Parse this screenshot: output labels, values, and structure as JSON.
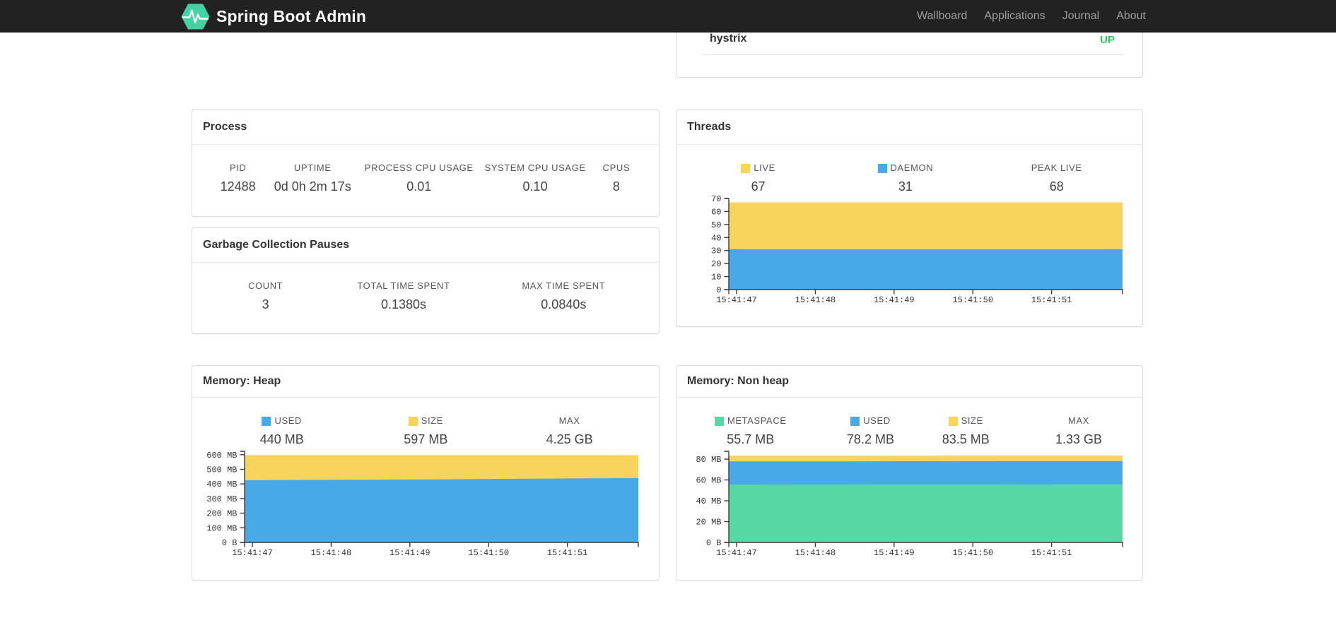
{
  "navbar": {
    "brand": "Spring Boot Admin",
    "items": [
      {
        "label": "Wallboard"
      },
      {
        "label": "Applications"
      },
      {
        "label": "Journal"
      },
      {
        "label": "About"
      }
    ]
  },
  "colors": {
    "brand_green": "#42d3a2",
    "status_up": "#28ca5f",
    "series_blue": "#48a9e9",
    "series_yellow": "#f8d45c",
    "series_green": "#56d8a4",
    "navbar_bg": "#222222"
  },
  "health_panel": {
    "rows": [
      {
        "name": "hystrix",
        "status": "UP"
      }
    ]
  },
  "process_panel": {
    "title": "Process",
    "metrics": [
      {
        "label": "PID",
        "value": "12488"
      },
      {
        "label": "UPTIME",
        "value": "0d 0h 2m 17s"
      },
      {
        "label": "PROCESS CPU USAGE",
        "value": "0.01"
      },
      {
        "label": "SYSTEM CPU USAGE",
        "value": "0.10"
      },
      {
        "label": "CPUS",
        "value": "8"
      }
    ]
  },
  "gc_panel": {
    "title": "Garbage Collection Pauses",
    "metrics": [
      {
        "label": "COUNT",
        "value": "3"
      },
      {
        "label": "TOTAL TIME SPENT",
        "value": "0.1380s"
      },
      {
        "label": "MAX TIME SPENT",
        "value": "0.0840s"
      }
    ]
  },
  "threads_panel": {
    "title": "Threads",
    "metrics": [
      {
        "label": "LIVE",
        "value": "67",
        "swatch": "#f8d45c"
      },
      {
        "label": "DAEMON",
        "value": "31",
        "swatch": "#48a9e9"
      },
      {
        "label": "PEAK LIVE",
        "value": "68"
      }
    ]
  },
  "heap_panel": {
    "title": "Memory: Heap",
    "metrics": [
      {
        "label": "USED",
        "value": "440 MB",
        "swatch": "#48a9e9"
      },
      {
        "label": "SIZE",
        "value": "597 MB",
        "swatch": "#f8d45c"
      },
      {
        "label": "MAX",
        "value": "4.25 GB"
      }
    ]
  },
  "nonheap_panel": {
    "title": "Memory: Non heap",
    "metrics": [
      {
        "label": "METASPACE",
        "value": "55.7 MB",
        "swatch": "#56d8a4"
      },
      {
        "label": "USED",
        "value": "78.2 MB",
        "swatch": "#48a9e9"
      },
      {
        "label": "SIZE",
        "value": "83.5 MB",
        "swatch": "#f8d45c"
      },
      {
        "label": "MAX",
        "value": "1.33 GB"
      }
    ]
  },
  "chart_data": [
    {
      "id": "threads",
      "type": "area",
      "title": "Threads",
      "y_axis_max": 70,
      "y_ticks": [
        {
          "v": 0,
          "label": "0"
        },
        {
          "v": 10,
          "label": "10"
        },
        {
          "v": 20,
          "label": "20"
        },
        {
          "v": 30,
          "label": "30"
        },
        {
          "v": 40,
          "label": "40"
        },
        {
          "v": 50,
          "label": "50"
        },
        {
          "v": 60,
          "label": "60"
        },
        {
          "v": 70,
          "label": "70"
        }
      ],
      "x_ticks": [
        {
          "f": 0.0198,
          "label": "15:41:47"
        },
        {
          "f": 0.2198,
          "label": "15:41:48"
        },
        {
          "f": 0.4198,
          "label": "15:41:49"
        },
        {
          "f": 0.6198,
          "label": "15:41:50"
        },
        {
          "f": 0.8198,
          "label": "15:41:51"
        }
      ],
      "series": [
        {
          "name": "LIVE",
          "color": "#f8d45c",
          "points": [
            [
              0,
              67
            ],
            [
              1,
              67
            ]
          ]
        },
        {
          "name": "DAEMON",
          "color": "#48a9e9",
          "points": [
            [
              0,
              31
            ],
            [
              1,
              31
            ]
          ]
        }
      ]
    },
    {
      "id": "heap",
      "type": "area",
      "title": "Memory: Heap",
      "y_axis_max": 623,
      "y_ticks": [
        {
          "v": 0,
          "label": "0 B"
        },
        {
          "v": 100,
          "label": "100 MB"
        },
        {
          "v": 200,
          "label": "200 MB"
        },
        {
          "v": 300,
          "label": "300 MB"
        },
        {
          "v": 400,
          "label": "400 MB"
        },
        {
          "v": 500,
          "label": "500 MB"
        },
        {
          "v": 600,
          "label": "600 MB"
        }
      ],
      "x_ticks": [
        {
          "f": 0.0198,
          "label": "15:41:47"
        },
        {
          "f": 0.2198,
          "label": "15:41:48"
        },
        {
          "f": 0.4198,
          "label": "15:41:49"
        },
        {
          "f": 0.6198,
          "label": "15:41:50"
        },
        {
          "f": 0.8198,
          "label": "15:41:51"
        }
      ],
      "series": [
        {
          "name": "SIZE",
          "color": "#f8d45c",
          "points": [
            [
              0,
              597
            ],
            [
              1,
              597
            ]
          ]
        },
        {
          "name": "USED",
          "color": "#48a9e9",
          "points": [
            [
              0,
              425
            ],
            [
              0.08,
              426
            ],
            [
              0.16,
              427.5
            ],
            [
              0.25,
              428.5
            ],
            [
              0.33,
              429
            ],
            [
              0.42,
              430.5
            ],
            [
              0.5,
              431.5
            ],
            [
              0.58,
              433
            ],
            [
              0.66,
              434.5
            ],
            [
              0.75,
              436
            ],
            [
              0.83,
              437.5
            ],
            [
              0.92,
              439
            ],
            [
              1,
              440
            ]
          ]
        }
      ]
    },
    {
      "id": "nonheap",
      "type": "area",
      "title": "Memory: Non heap",
      "y_axis_max": 87.5,
      "y_ticks": [
        {
          "v": 0,
          "label": "0 B"
        },
        {
          "v": 20,
          "label": "20 MB"
        },
        {
          "v": 40,
          "label": "40 MB"
        },
        {
          "v": 60,
          "label": "60 MB"
        },
        {
          "v": 80,
          "label": "80 MB"
        }
      ],
      "x_ticks": [
        {
          "f": 0.0198,
          "label": "15:41:47"
        },
        {
          "f": 0.2198,
          "label": "15:41:48"
        },
        {
          "f": 0.4198,
          "label": "15:41:49"
        },
        {
          "f": 0.6198,
          "label": "15:41:50"
        },
        {
          "f": 0.8198,
          "label": "15:41:51"
        }
      ],
      "series": [
        {
          "name": "SIZE",
          "color": "#f8d45c",
          "points": [
            [
              0,
              83.2
            ],
            [
              0.52,
              83.2
            ],
            [
              0.54,
              83.5
            ],
            [
              1,
              83.5
            ]
          ]
        },
        {
          "name": "USED",
          "color": "#48a9e9",
          "points": [
            [
              0,
              77.8
            ],
            [
              0.3,
              77.9
            ],
            [
              0.48,
              78.0
            ],
            [
              0.6,
              78.1
            ],
            [
              0.75,
              78.2
            ],
            [
              1,
              78.2
            ]
          ]
        },
        {
          "name": "METASPACE",
          "color": "#56d8a4",
          "points": [
            [
              0,
              55.5
            ],
            [
              0.5,
              55.6
            ],
            [
              1,
              55.7
            ]
          ]
        }
      ]
    }
  ]
}
